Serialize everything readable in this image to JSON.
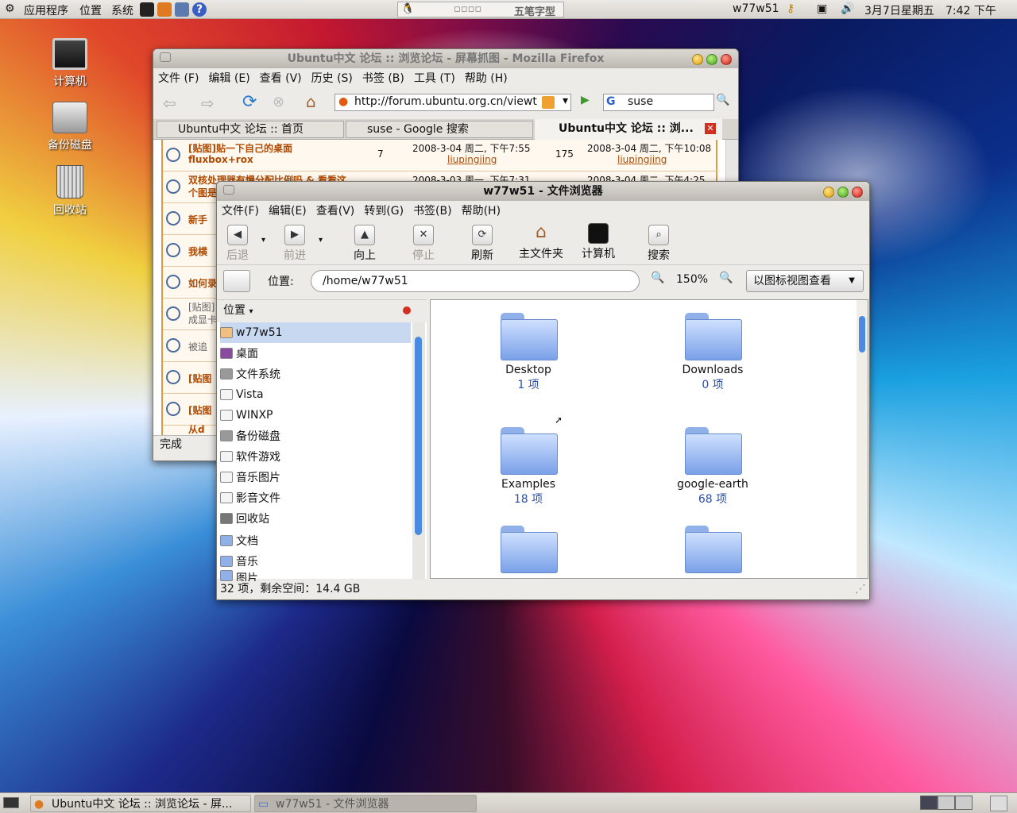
{
  "topbar": {
    "menus": [
      "应用程序",
      "位置",
      "系统"
    ],
    "input_method": "五笔字型",
    "username": "w77w51",
    "date": "3月7日星期五",
    "time": "7:42 下午"
  },
  "desktop": {
    "icons": [
      "计算机",
      "备份磁盘",
      "回收站"
    ]
  },
  "firefox": {
    "title": "Ubuntu中文 论坛 :: 浏览论坛 - 屏幕抓图 - Mozilla Firefox",
    "menus": [
      "文件 (F)",
      "编辑 (E)",
      "查看 (V)",
      "历史 (S)",
      "书签 (B)",
      "工具 (T)",
      "帮助 (H)"
    ],
    "url": "http://forum.ubuntu.org.cn/viewt",
    "search_value": "suse",
    "search_engine_icon": "G",
    "tabs": [
      "Ubuntu中文 论坛 :: 首页",
      "suse - Google 搜索",
      "Ubuntu中文 论坛 :: 浏..."
    ],
    "rows": [
      {
        "title": "[贴图]贴一下自己的桌面",
        "title2": "fluxbox+rox",
        "replies": "7",
        "posted": "2008-3-04 周二, 下午7:55",
        "author": "liupingjing",
        "views": "175",
        "last": "2008-3-04 周二, 下午10:08",
        "last_author": "liupingjing"
      },
      {
        "title": "双核处理器有慢分配比例吗 & 看看这",
        "title2": "个图是",
        "replies": "",
        "posted": "2008-3-03 周一, 下午7:31",
        "author": "",
        "views": "",
        "last": "2008-3-04 周二, 下午4:25",
        "last_author": ""
      },
      {
        "title": "新手",
        "title2": "",
        "replies": "",
        "posted": "",
        "author": "",
        "views": "",
        "last": "",
        "last_author": ""
      },
      {
        "title": "我横",
        "title2": "",
        "replies": "",
        "posted": "",
        "author": "",
        "views": "",
        "last": "",
        "last_author": ""
      },
      {
        "title": "如何录",
        "title2": "",
        "replies": "",
        "posted": "",
        "author": "",
        "views": "",
        "last": "",
        "last_author": ""
      },
      {
        "title": "[贴图]",
        "title2": "成显卡",
        "replies": "",
        "posted": "",
        "author": "",
        "views": "",
        "last": "",
        "last_author": ""
      },
      {
        "title": "被追",
        "title2": "",
        "replies": "",
        "posted": "",
        "author": "",
        "views": "",
        "last": "",
        "last_author": ""
      },
      {
        "title": "[贴图",
        "title2": "",
        "replies": "",
        "posted": "",
        "author": "",
        "views": "",
        "last": "",
        "last_author": ""
      },
      {
        "title": "[贴图",
        "title2": "",
        "replies": "",
        "posted": "",
        "author": "",
        "views": "",
        "last": "",
        "last_author": ""
      },
      {
        "title": "从d",
        "title2": "",
        "replies": "",
        "posted": "",
        "author": "",
        "views": "",
        "last": "",
        "last_author": ""
      }
    ],
    "status": "完成"
  },
  "nautilus": {
    "title": "w77w51 - 文件浏览器",
    "menus": [
      "文件(F)",
      "编辑(E)",
      "查看(V)",
      "转到(G)",
      "书签(B)",
      "帮助(H)"
    ],
    "toolbar": {
      "back": "后退",
      "forward": "前进",
      "up": "向上",
      "stop": "停止",
      "reload": "刷新",
      "home": "主文件夹",
      "computer": "计算机",
      "search": "搜索"
    },
    "location_label": "位置:",
    "location": "/home/w77w51",
    "zoom": "150%",
    "view_mode": "以图标视图查看",
    "sidebar_header": "位置",
    "sidebar_items": [
      "w77w51",
      "桌面",
      "文件系统",
      "Vista",
      "WINXP",
      "备份磁盘",
      "软件游戏",
      "音乐图片",
      "影音文件",
      "回收站",
      "文档",
      "音乐",
      "图片"
    ],
    "folders": [
      {
        "name": "Desktop",
        "count": "1 项"
      },
      {
        "name": "Downloads",
        "count": "0 项"
      },
      {
        "name": "Examples",
        "count": "18 项"
      },
      {
        "name": "google-earth",
        "count": "68 项"
      },
      {
        "name": "",
        "count": ""
      },
      {
        "name": "",
        "count": ""
      }
    ],
    "status": "32 项，剩余空间：14.4 GB"
  },
  "taskbar": {
    "tasks": [
      "Ubuntu中文 论坛 :: 浏览论坛 - 屏...",
      "w77w51 - 文件浏览器"
    ]
  }
}
